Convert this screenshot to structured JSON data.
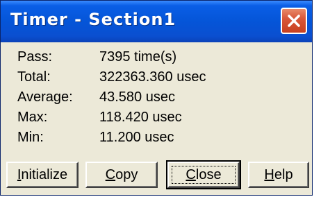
{
  "window": {
    "title": "Timer - Section1"
  },
  "stats": [
    {
      "label": "Pass:",
      "value": "7395 time(s)"
    },
    {
      "label": "Total:",
      "value": "322363.360 usec"
    },
    {
      "label": "Average:",
      "value": "43.580 usec"
    },
    {
      "label": "Max:",
      "value": "118.420 usec"
    },
    {
      "label": "Min:",
      "value": "11.200 usec"
    }
  ],
  "buttons": {
    "initialize": {
      "label": "Initialize",
      "mnemonic": "I",
      "rest": "nitialize"
    },
    "copy": {
      "label": "Copy",
      "mnemonic": "C",
      "rest": "opy"
    },
    "close": {
      "label": "Close",
      "mnemonic": "C",
      "rest": "lose"
    },
    "help": {
      "label": "Help",
      "mnemonic": "H",
      "rest": "elp"
    }
  },
  "colors": {
    "titlebar": "#0555d8",
    "face": "#ece9d8",
    "close_button": "#c8401f"
  },
  "icons": {
    "close": "close-icon"
  }
}
